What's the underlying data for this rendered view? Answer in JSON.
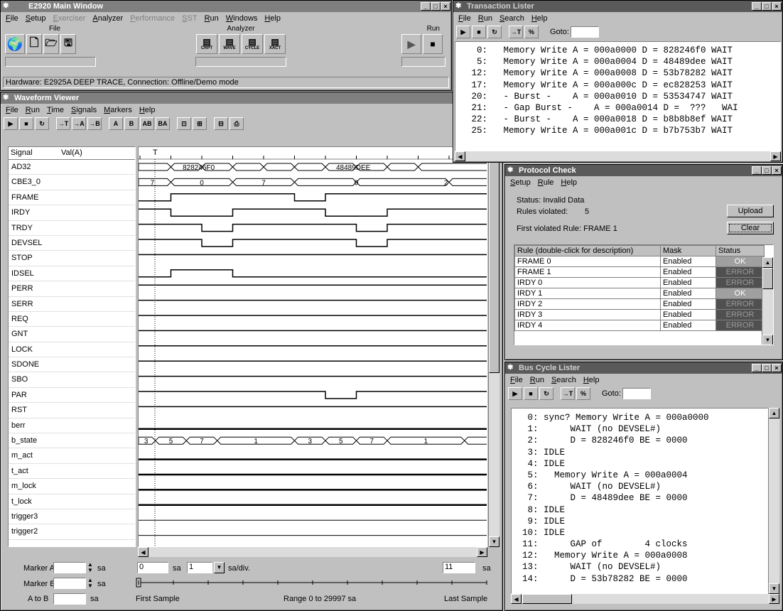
{
  "main": {
    "title": "E2920 Main Window",
    "menu": [
      {
        "label": "File",
        "dim": false
      },
      {
        "label": "Setup",
        "dim": false
      },
      {
        "label": "Exerciser",
        "dim": true
      },
      {
        "label": "Analyzer",
        "dim": false
      },
      {
        "label": "Performance",
        "dim": true
      },
      {
        "label": "SST",
        "dim": true
      },
      {
        "label": "Run",
        "dim": false
      },
      {
        "label": "Windows",
        "dim": false
      },
      {
        "label": "Help",
        "dim": false
      }
    ],
    "group_file": "File",
    "group_analyzer": "Analyzer",
    "group_run": "Run",
    "analyzer_buttons": [
      "CRPT",
      "WAVE",
      "CYCLE",
      "XACT"
    ],
    "status": "Hardware: E2925A DEEP TRACE, Connection: Offline/Demo mode"
  },
  "waveform": {
    "title": "Waveform Viewer",
    "menu": [
      "File",
      "Run",
      "Time",
      "Signals",
      "Markers",
      "Help"
    ],
    "header_signal": "Signal",
    "header_val": "Val(A)",
    "trigger_label": "T",
    "signals": [
      "AD32",
      "CBE3_0",
      "FRAME",
      "IRDY",
      "TRDY",
      "DEVSEL",
      "STOP",
      "IDSEL",
      "PERR",
      "SERR",
      "REQ",
      "GNT",
      "LOCK",
      "SDONE",
      "SBO",
      "PAR",
      "RST",
      "berr",
      "b_state",
      "m_act",
      "t_act",
      "m_lock",
      "t_lock",
      "trigger3",
      "trigger2"
    ],
    "ad32_values": [
      "828246F0",
      "48489DEE"
    ],
    "cbe_values": [
      "7",
      "0",
      "7",
      "0",
      "2"
    ],
    "bstate_values": [
      "3",
      "5",
      "7",
      "1",
      "3",
      "5",
      "7",
      "1"
    ],
    "marker_a_label": "Marker A",
    "marker_b_label": "Marker B",
    "a_to_b_label": "A to B",
    "unit_sa": "sa",
    "start_value": "0",
    "div_value": "1",
    "div_unit": "sa/div.",
    "end_value": "11",
    "end_unit": "sa",
    "first_sample": "First Sample",
    "range": "Range 0 to 29997 sa",
    "last_sample": "Last Sample"
  },
  "transaction": {
    "title": "Transaction Lister",
    "menu": [
      "File",
      "Run",
      "Search",
      "Help"
    ],
    "goto_label": "Goto:",
    "rows": [
      "    0:   Memory Write A = 000a0000 D = 828246f0 WAIT",
      "    5:   Memory Write A = 000a0004 D = 48489dee WAIT",
      "   12:   Memory Write A = 000a0008 D = 53b78282 WAIT",
      "   17:   Memory Write A = 000a000c D = ec828253 WAIT",
      "   20:   - Burst -    A = 000a0010 D = 53534747 WAIT",
      "   21:   - Gap Burst -    A = 000a0014 D =  ???   WAI",
      "   22:   - Burst -    A = 000a0018 D = b8b8b8ef WAIT",
      "   25:   Memory Write A = 000a001c D = b7b753b7 WAIT"
    ]
  },
  "protocol": {
    "title": "Protocol Check",
    "menu": [
      "Setup",
      "Rule",
      "Help"
    ],
    "status_label": "Status: Invalid Data",
    "rules_violated_label": "Rules violated:",
    "rules_violated_count": "5",
    "first_violated": "First violated Rule: FRAME 1",
    "upload_label": "Upload",
    "clear_label": "Clear",
    "col_rule": "Rule (double-click for description)",
    "col_mask": "Mask",
    "col_status": "Status",
    "rules": [
      {
        "rule": "FRAME 0",
        "mask": "Enabled",
        "status": "OK"
      },
      {
        "rule": "FRAME 1",
        "mask": "Enabled",
        "status": "ERROR"
      },
      {
        "rule": "IRDY 0",
        "mask": "Enabled",
        "status": "ERROR"
      },
      {
        "rule": "IRDY 1",
        "mask": "Enabled",
        "status": "OK"
      },
      {
        "rule": "IRDY 2",
        "mask": "Enabled",
        "status": "ERROR"
      },
      {
        "rule": "IRDY 3",
        "mask": "Enabled",
        "status": "ERROR"
      },
      {
        "rule": "IRDY 4",
        "mask": "Enabled",
        "status": "ERROR"
      }
    ]
  },
  "buscycle": {
    "title": "Bus Cycle Lister",
    "menu": [
      "File",
      "Run",
      "Search",
      "Help"
    ],
    "goto_label": "Goto:",
    "rows": [
      "   0: sync? Memory Write A = 000a0000",
      "   1:      WAIT (no DEVSEL#)",
      "   2:      D = 828246f0 BE = 0000",
      "   3: IDLE",
      "   4: IDLE",
      "   5:   Memory Write A = 000a0004",
      "   6:      WAIT (no DEVSEL#)",
      "   7:      D = 48489dee BE = 0000",
      "   8: IDLE",
      "   9: IDLE",
      "  10: IDLE",
      "  11:      GAP of        4 clocks",
      "  12:   Memory Write A = 000a0008",
      "  13:      WAIT (no DEVSEL#)",
      "  14:      D = 53b78282 BE = 0000"
    ]
  }
}
